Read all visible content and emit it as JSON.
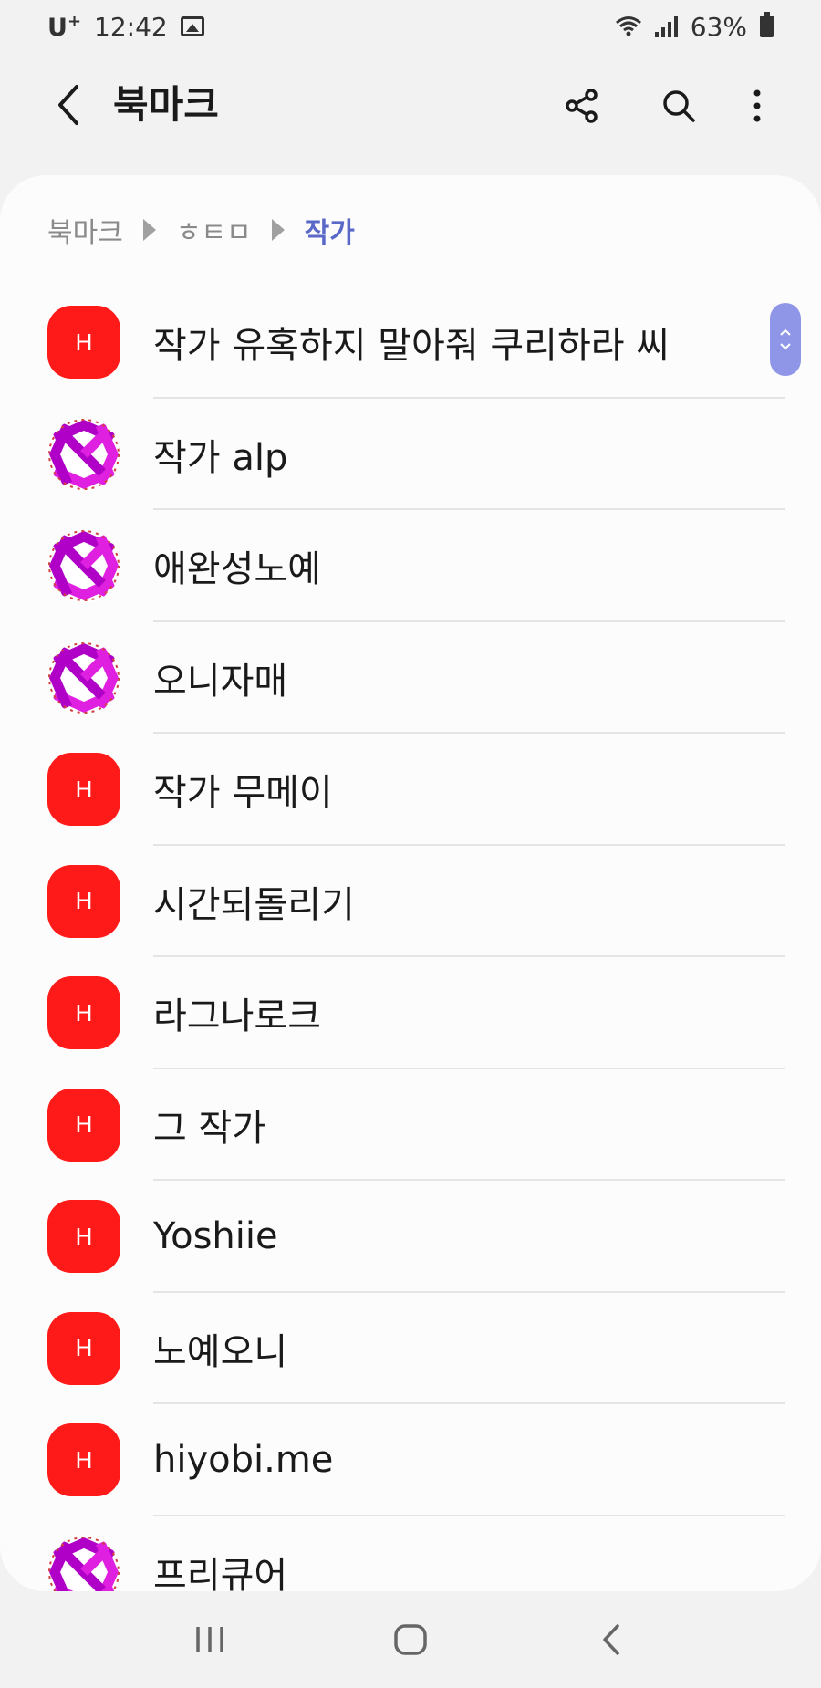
{
  "status_bar": {
    "carrier": "U",
    "carrier_sup": "+",
    "time": "12:42",
    "battery": "63%"
  },
  "app_bar": {
    "title": "북마크",
    "icons": [
      "back-icon",
      "share-icon",
      "search-icon",
      "more-vertical-icon"
    ]
  },
  "breadcrumb": {
    "items": [
      "북마크",
      "ㅎㅌㅁ",
      "작가"
    ]
  },
  "bookmarks": [
    {
      "label": "작가 유혹하지 말아줘 쿠리하라 씨",
      "icon": "h",
      "icon_text": "H"
    },
    {
      "label": "작가 alp",
      "icon": "swirl"
    },
    {
      "label": "애완성노예",
      "icon": "swirl"
    },
    {
      "label": "오니자매",
      "icon": "swirl"
    },
    {
      "label": "작가 무메이",
      "icon": "h",
      "icon_text": "H"
    },
    {
      "label": "시간되돌리기",
      "icon": "h",
      "icon_text": "H"
    },
    {
      "label": "라그나로크",
      "icon": "h",
      "icon_text": "H"
    },
    {
      "label": "그 작가",
      "icon": "h",
      "icon_text": "H"
    },
    {
      "label": "Yoshiie",
      "icon": "h",
      "icon_text": "H"
    },
    {
      "label": "노예오니",
      "icon": "h",
      "icon_text": "H"
    },
    {
      "label": "hiyobi.me",
      "icon": "h",
      "icon_text": "H"
    },
    {
      "label": "프리큐어",
      "icon": "swirl"
    }
  ],
  "colors": {
    "favicon_red": "#ff1a1a",
    "accent": "#5a68c8",
    "scroll_thumb": "#8f96e8"
  }
}
